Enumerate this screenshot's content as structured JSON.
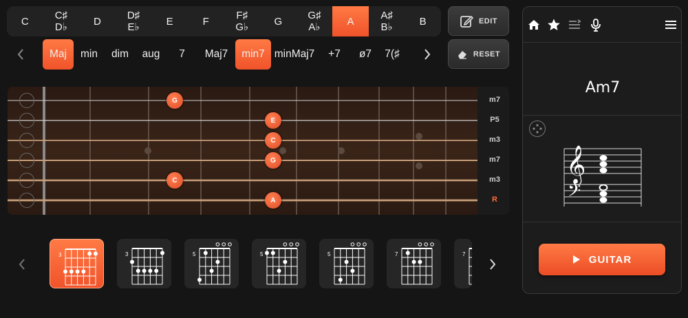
{
  "root_notes": [
    {
      "line1": "C",
      "line2": "",
      "active": false
    },
    {
      "line1": "C♯",
      "line2": "D♭",
      "active": false
    },
    {
      "line1": "D",
      "line2": "",
      "active": false
    },
    {
      "line1": "D♯",
      "line2": "E♭",
      "active": false
    },
    {
      "line1": "E",
      "line2": "",
      "active": false
    },
    {
      "line1": "F",
      "line2": "",
      "active": false
    },
    {
      "line1": "F♯",
      "line2": "G♭",
      "active": false
    },
    {
      "line1": "G",
      "line2": "",
      "active": false
    },
    {
      "line1": "G♯",
      "line2": "A♭",
      "active": false
    },
    {
      "line1": "A",
      "line2": "",
      "active": true
    },
    {
      "line1": "A♯",
      "line2": "B♭",
      "active": false
    },
    {
      "line1": "B",
      "line2": "",
      "active": false
    }
  ],
  "qualities": [
    {
      "label": "Maj",
      "active": true
    },
    {
      "label": "min",
      "active": false
    },
    {
      "label": "dim",
      "active": false
    },
    {
      "label": "aug",
      "active": false
    },
    {
      "label": "7",
      "active": false
    },
    {
      "label": "Maj7",
      "active": false
    },
    {
      "label": "min7",
      "active": true
    },
    {
      "label": "minMaj7",
      "active": false
    },
    {
      "label": "+7",
      "active": false
    },
    {
      "label": "ø7",
      "active": false
    },
    {
      "label": "7(♯",
      "active": false
    }
  ],
  "toolbar": {
    "edit_label": "EDIT",
    "reset_label": "RESET"
  },
  "fretboard": {
    "intervals": [
      "m7",
      "P5",
      "m3",
      "m7",
      "m3",
      "R"
    ],
    "notes": [
      {
        "string": 1,
        "fret": 3,
        "label": "G"
      },
      {
        "string": 2,
        "fret": 5,
        "label": "E"
      },
      {
        "string": 3,
        "fret": 5,
        "label": "C"
      },
      {
        "string": 4,
        "fret": 5,
        "label": "G"
      },
      {
        "string": 5,
        "fret": 3,
        "label": "C"
      },
      {
        "string": 6,
        "fret": 5,
        "label": "A"
      }
    ]
  },
  "voicings": [
    {
      "fret": "3",
      "active": true
    },
    {
      "fret": "3",
      "active": false
    },
    {
      "fret": "5",
      "active": false
    },
    {
      "fret": "5",
      "active": false
    },
    {
      "fret": "5",
      "active": false
    },
    {
      "fret": "7",
      "active": false
    },
    {
      "fret": "7",
      "active": false
    }
  ],
  "panel": {
    "icons": [
      "home-icon",
      "star-icon",
      "list-icon",
      "microphone-icon",
      "menu-icon"
    ],
    "chord_name": "Am7",
    "play_button_label": "GUITAR"
  },
  "colors": {
    "accent": "#f0532a",
    "background": "#151515"
  }
}
